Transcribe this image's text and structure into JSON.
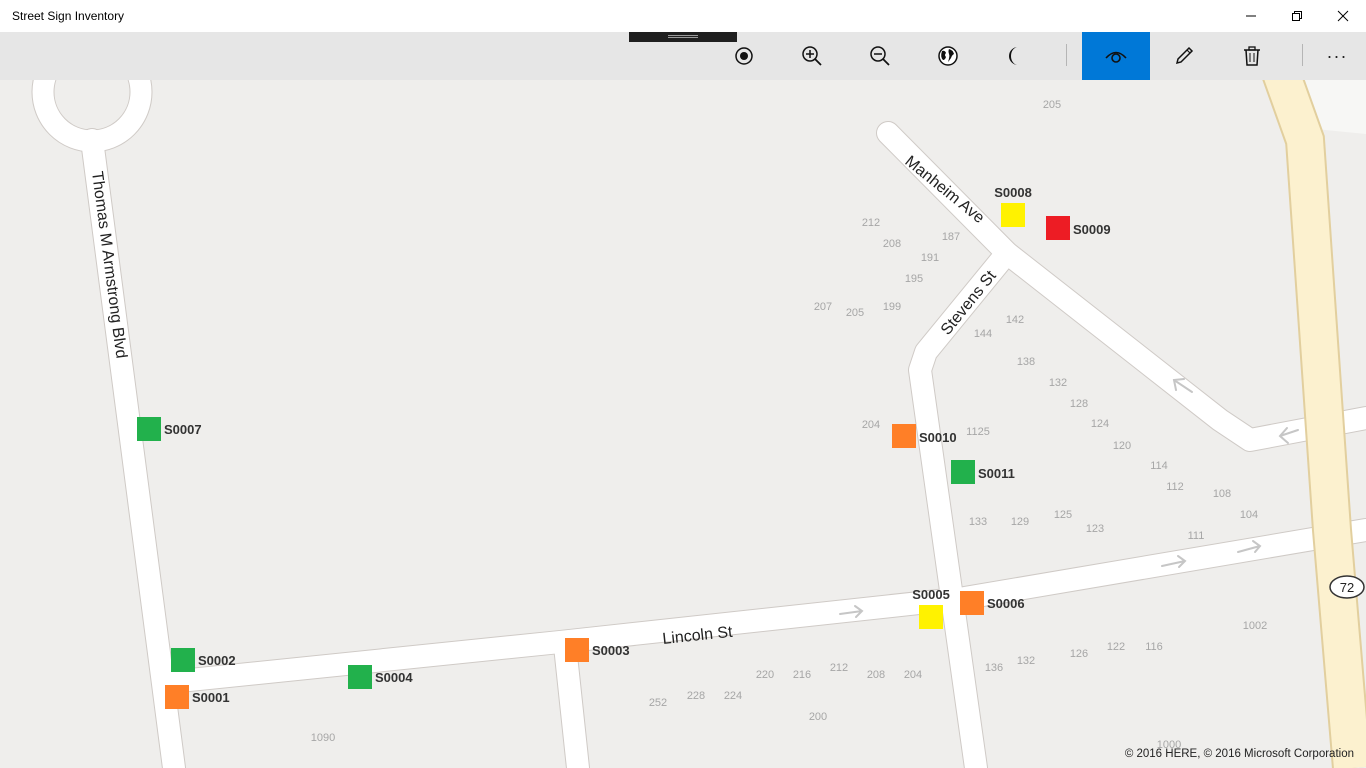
{
  "window": {
    "title": "Street Sign Inventory"
  },
  "toolbar": {
    "buttons": [
      {
        "name": "location-button",
        "icon": "target-icon"
      },
      {
        "name": "zoom-in-button",
        "icon": "zoom-in-icon"
      },
      {
        "name": "zoom-out-button",
        "icon": "zoom-out-icon"
      },
      {
        "name": "aerial-view-button",
        "icon": "globe-icon"
      },
      {
        "name": "night-mode-button",
        "icon": "moon-icon"
      },
      {
        "name": "view-mode-button",
        "icon": "eye-icon",
        "active": true
      },
      {
        "name": "edit-button",
        "icon": "pencil-icon"
      },
      {
        "name": "delete-button",
        "icon": "trash-icon"
      }
    ],
    "more_label": "···",
    "accent_color": "#0078d7"
  },
  "map": {
    "streets": {
      "armstrong": "Thomas  M  Armstrong  Blvd",
      "manheim": "Manheim  Ave",
      "stevens": "Stevens  St",
      "lincoln": "Lincoln  St",
      "route_shield": "72"
    },
    "house_numbers": [
      "205",
      "212",
      "208",
      "187",
      "191",
      "195",
      "207",
      "205",
      "199",
      "142",
      "144",
      "138",
      "132",
      "128",
      "124",
      "120",
      "114",
      "112",
      "108",
      "104",
      "204",
      "1125",
      "133",
      "129",
      "125",
      "123",
      "111",
      "1002",
      "136",
      "132",
      "126",
      "122",
      "116",
      "220",
      "216",
      "212",
      "208",
      "204",
      "252",
      "228",
      "224",
      "200",
      "1090",
      "1000"
    ],
    "signs": [
      {
        "id": "S0001",
        "status": "orange"
      },
      {
        "id": "S0002",
        "status": "green"
      },
      {
        "id": "S0003",
        "status": "orange"
      },
      {
        "id": "S0004",
        "status": "green"
      },
      {
        "id": "S0005",
        "status": "yellow"
      },
      {
        "id": "S0006",
        "status": "orange"
      },
      {
        "id": "S0007",
        "status": "green"
      },
      {
        "id": "S0008",
        "status": "yellow"
      },
      {
        "id": "S0009",
        "status": "red"
      },
      {
        "id": "S0010",
        "status": "orange"
      },
      {
        "id": "S0011",
        "status": "green"
      }
    ],
    "status_colors": {
      "green": "#22b14c",
      "orange": "#ff7f27",
      "yellow": "#fff200",
      "red": "#ed1c24"
    },
    "copyright": "© 2016 HERE, © 2016 Microsoft Corporation"
  }
}
